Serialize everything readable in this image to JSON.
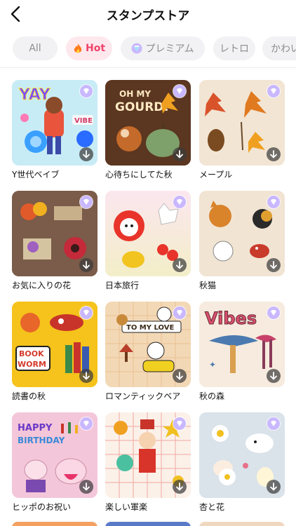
{
  "header": {
    "title": "スタンプストア"
  },
  "tabs": [
    {
      "label": "All",
      "icon": ""
    },
    {
      "label": "Hot",
      "icon": "fire-icon"
    },
    {
      "label": "プレミアム",
      "icon": "premium-gem-icon"
    },
    {
      "label": "レトロ",
      "icon": ""
    },
    {
      "label": "かわい",
      "icon": ""
    }
  ],
  "stickers": [
    {
      "title": "Y世代ベイブ"
    },
    {
      "title": "心待ちにしてた秋",
      "art_text": "OH MY GOURD!"
    },
    {
      "title": "メープル"
    },
    {
      "title": "お気に入りの花"
    },
    {
      "title": "日本旅行"
    },
    {
      "title": "秋猫"
    },
    {
      "title": "読書の秋",
      "art_text": "BOOK WORM"
    },
    {
      "title": "ロマンティックベア",
      "art_text": "TO MY LOVE"
    },
    {
      "title": "秋の森",
      "art_text": "Vibes"
    },
    {
      "title": "ヒッポのお祝い",
      "art_text": "HAPPY BIRTHDAY"
    },
    {
      "title": "楽しい軍楽"
    },
    {
      "title": "杏と花"
    }
  ],
  "colors": {
    "accent": "#f0426a",
    "tab_bg": "#f2f2f4"
  }
}
